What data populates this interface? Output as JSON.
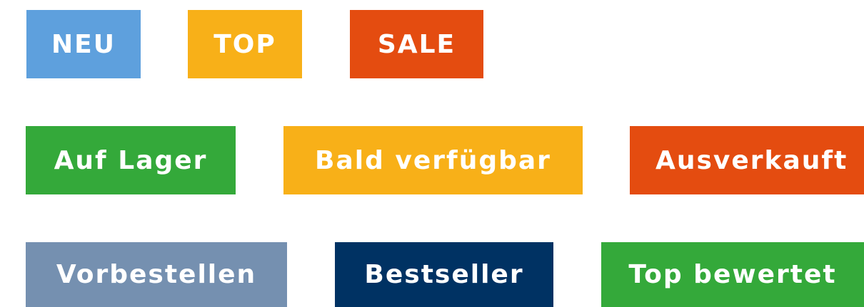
{
  "badges": {
    "neu": {
      "label": "NEU",
      "color": "#5ea0dd"
    },
    "top": {
      "label": "TOP",
      "color": "#f8b018"
    },
    "sale": {
      "label": "SALE",
      "color": "#e44c10"
    },
    "auf_lager": {
      "label": "Auf Lager",
      "color": "#34a93a"
    },
    "bald_verfuegbar": {
      "label": "Bald verfügbar",
      "color": "#f8b018"
    },
    "ausverkauft": {
      "label": "Ausverkauft",
      "color": "#e44c10"
    },
    "vorbestellen": {
      "label": "Vorbestellen",
      "color": "#7590b0"
    },
    "bestseller": {
      "label": "Bestseller",
      "color": "#003263"
    },
    "top_bewertet": {
      "label": "Top bewertet",
      "color": "#34a93a"
    }
  }
}
